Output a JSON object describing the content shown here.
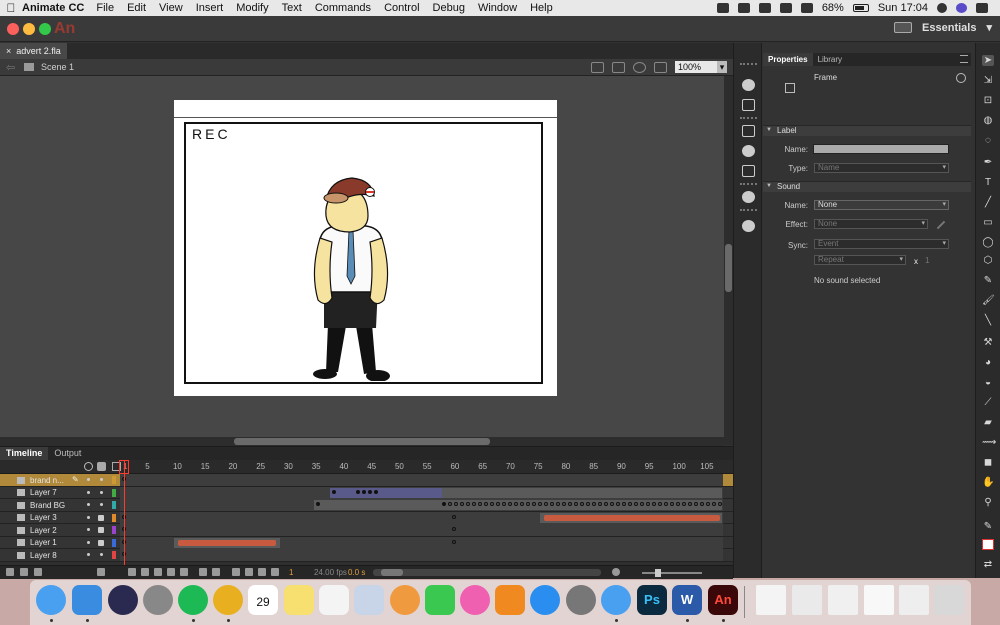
{
  "menubar": {
    "app_name": "Animate CC",
    "items": [
      "File",
      "Edit",
      "View",
      "Insert",
      "Modify",
      "Text",
      "Commands",
      "Control",
      "Debug",
      "Window",
      "Help"
    ],
    "battery": "68%",
    "battery_level": 0.68,
    "clock": "Sun 17:04"
  },
  "titlebar": {
    "logo": "An",
    "workspace": "Essentials"
  },
  "document": {
    "tab_title": "advert 2.fla",
    "close": "×",
    "back_arrow": "⇦",
    "scene": "Scene 1",
    "zoom": "100%",
    "zoom_chevron": "▾"
  },
  "stage": {
    "rec_text": "REC"
  },
  "timeline": {
    "tabs": [
      "Timeline",
      "Output"
    ],
    "ruler": [
      "1",
      "5",
      "10",
      "15",
      "20",
      "25",
      "30",
      "35",
      "40",
      "45",
      "50",
      "55",
      "60",
      "65",
      "70",
      "75",
      "80",
      "85",
      "90",
      "95",
      "100",
      "105"
    ],
    "current_frame": "1",
    "fps": "24.00 fps",
    "seconds": "0.0 s",
    "pencil": "✎",
    "layers": [
      {
        "name": "brand n...",
        "color": "#cc9933",
        "selected": true,
        "locked": false
      },
      {
        "name": "Layer 7",
        "color": "#44aa44",
        "selected": false,
        "locked": false
      },
      {
        "name": "Brand BG",
        "color": "#33aaaa",
        "selected": false,
        "locked": false
      },
      {
        "name": "Layer 3",
        "color": "#e08a2a",
        "selected": false,
        "locked": true
      },
      {
        "name": "Layer 2",
        "color": "#9a44cc",
        "selected": false,
        "locked": true
      },
      {
        "name": "Layer 1",
        "color": "#3a6ad8",
        "selected": false,
        "locked": true
      },
      {
        "name": "Layer 8",
        "color": "#e04444",
        "selected": false,
        "locked": false
      }
    ]
  },
  "properties": {
    "tabs": [
      "Properties",
      "Library"
    ],
    "object_type": "Frame",
    "label_section": "Label",
    "name_label": "Name:",
    "type_label": "Type:",
    "type_value": "Name",
    "sound_section": "Sound",
    "sound_name_label": "Name:",
    "sound_name_value": "None",
    "effect_label": "Effect:",
    "effect_value": "None",
    "sync_label": "Sync:",
    "sync_value": "Event",
    "repeat_value": "Repeat",
    "repeat_x": "x",
    "repeat_count": "1",
    "no_sound": "No sound selected"
  },
  "dock": {
    "calendar_day": "29",
    "photoshop": "Ps",
    "word": "W",
    "animate": "An"
  },
  "colors": {
    "accent_selected_layer": "#b08a3a",
    "playhead": "#ff3b2f",
    "audio_wave": "#c85a40",
    "animate_red": "#d83a2c"
  }
}
